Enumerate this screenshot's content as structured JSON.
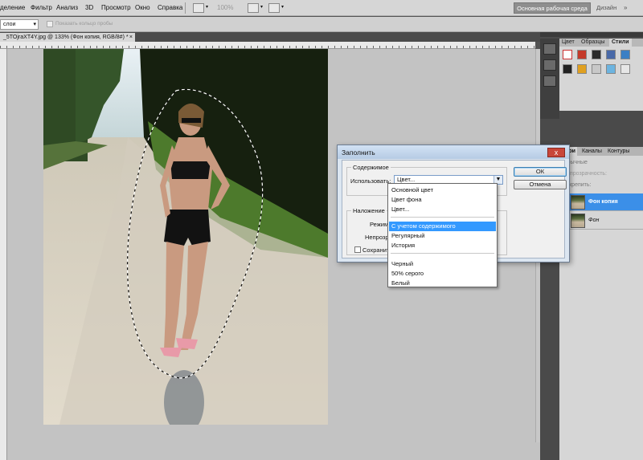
{
  "menu": {
    "items": [
      "деление",
      "Фильтр",
      "Анализ",
      "3D",
      "Просмотр",
      "Окно",
      "Справка"
    ],
    "zoom": "100%",
    "workspace_button": "Основная рабочая среда",
    "design_link": "Дизайн",
    "more": "»"
  },
  "options": {
    "layer_select": "слои",
    "rings_label": "Показать кольцо пробы"
  },
  "document": {
    "tab_title": "_5TOjraXT4Y.jpg @ 133% (Фон копия, RGB/8#) *",
    "close_glyph": "×"
  },
  "panels": {
    "color_tabs": [
      "Цвет",
      "Образцы",
      "Стили"
    ],
    "layers_tabs": [
      "Слои",
      "Каналы",
      "Контуры"
    ],
    "blend_mode": "Обычные",
    "opacity_label": "Непрозрачность:",
    "lock_label": "Закрепить:",
    "layers": [
      {
        "name": "Фон копия",
        "selected": true
      },
      {
        "name": "Фон",
        "selected": false
      }
    ]
  },
  "dialog": {
    "title": "Заполнить",
    "close_glyph": "x",
    "contents_legend": "Содержимое",
    "use_label": "Использовать:",
    "use_value": "Цвет...",
    "blending_legend": "Наложение",
    "mode_label": "Режим:",
    "opacity_label": "Непрозр.:",
    "keep_label": "Сохранить п",
    "ok_label": "ОК",
    "cancel_label": "Отмена"
  },
  "dropdown": {
    "group1": [
      "Основной цвет",
      "Цвет фона",
      "Цвет..."
    ],
    "group2": [
      "С учетом содержимого",
      "Регулярный",
      "История"
    ],
    "group3": [
      "Черный",
      "50% серого",
      "Белый"
    ],
    "highlighted": "С учетом содержимого"
  }
}
